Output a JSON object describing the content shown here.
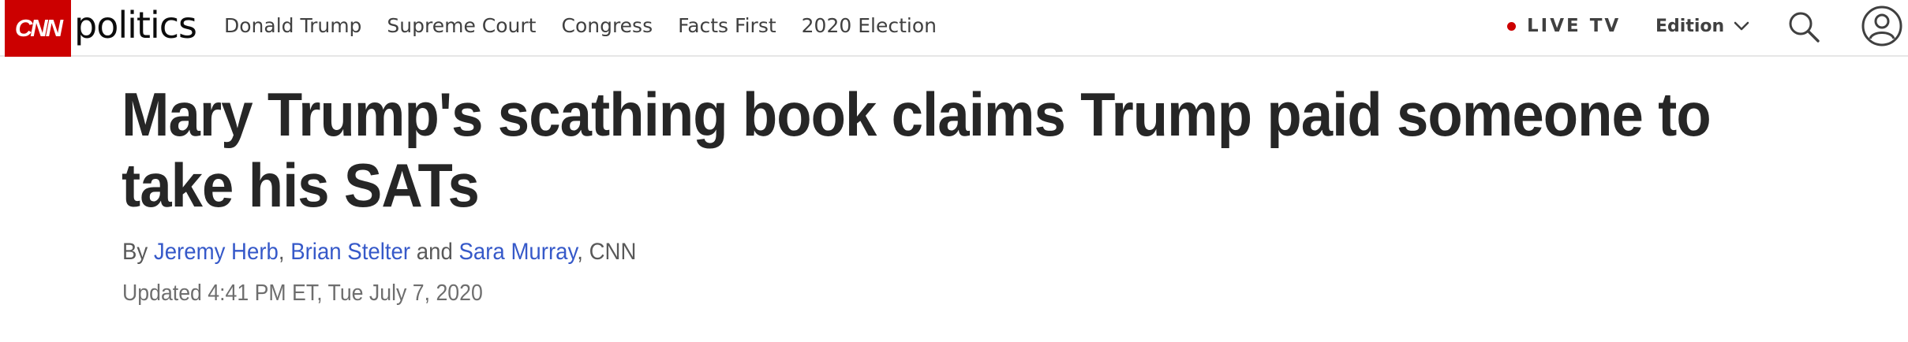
{
  "header": {
    "logo_text": "CNN",
    "section": "politics",
    "nav": [
      {
        "label": "Donald Trump"
      },
      {
        "label": "Supreme Court"
      },
      {
        "label": "Congress"
      },
      {
        "label": "Facts First"
      },
      {
        "label": "2020 Election"
      }
    ],
    "live_tv": "LIVE TV",
    "edition": "Edition",
    "icons": [
      "search-icon",
      "account-icon",
      "chevron-down-icon"
    ],
    "colors": {
      "brand": "#cc0000",
      "link": "#3659c9",
      "text": "#262626"
    }
  },
  "article": {
    "headline": "Mary Trump's scathing book claims Trump paid someone to take his SATs",
    "byline": {
      "prefix": "By ",
      "authors": [
        "Jeremy Herb",
        "Brian Stelter",
        "Sara Murray"
      ],
      "sep1": ", ",
      "sep2": " and ",
      "suffix": ", CNN"
    },
    "updated": "Updated 4:41 PM ET, Tue July 7, 2020"
  }
}
